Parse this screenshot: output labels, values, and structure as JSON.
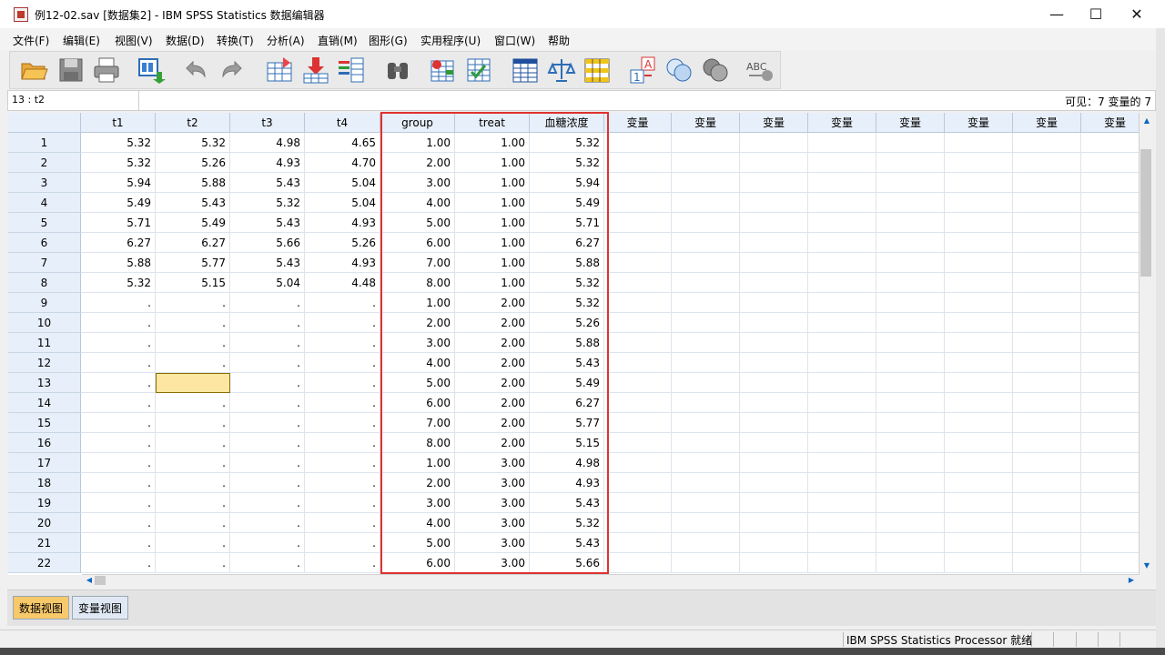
{
  "window": {
    "title": "例12-02.sav [数据集2] - IBM SPSS Statistics 数据编辑器",
    "minimize": "—",
    "maximize": "☐",
    "close": "✕"
  },
  "menu": [
    "文件(F)",
    "编辑(E)",
    "视图(V)",
    "数据(D)",
    "转换(T)",
    "分析(A)",
    "直销(M)",
    "图形(G)",
    "实用程序(U)",
    "窗口(W)",
    "帮助"
  ],
  "toolbar_icons": [
    "open-file-icon",
    "save-icon",
    "print-icon",
    "recall-dialog-icon",
    "undo-icon",
    "redo-icon",
    "goto-case-icon",
    "goto-variable-icon",
    "variables-icon",
    "find-icon",
    "insert-cases-icon",
    "insert-variable-icon",
    "split-file-icon",
    "weight-cases-icon",
    "select-cases-icon",
    "value-labels-icon",
    "use-sets-icon",
    "show-all-variables-icon",
    "spell-check-icon"
  ],
  "cell_reference": "13 : t2",
  "visible_info": "可见：7 变量的 7",
  "columns": [
    "t1",
    "t2",
    "t3",
    "t4",
    "group",
    "treat",
    "血糖浓度",
    "变量",
    "变量",
    "变量",
    "变量",
    "变量",
    "变量",
    "变量",
    "变量"
  ],
  "rows": [
    {
      "n": "1",
      "t1": "5.32",
      "t2": "5.32",
      "t3": "4.98",
      "t4": "4.65",
      "group": "1.00",
      "treat": "1.00",
      "xt": "5.32"
    },
    {
      "n": "2",
      "t1": "5.32",
      "t2": "5.26",
      "t3": "4.93",
      "t4": "4.70",
      "group": "2.00",
      "treat": "1.00",
      "xt": "5.32"
    },
    {
      "n": "3",
      "t1": "5.94",
      "t2": "5.88",
      "t3": "5.43",
      "t4": "5.04",
      "group": "3.00",
      "treat": "1.00",
      "xt": "5.94"
    },
    {
      "n": "4",
      "t1": "5.49",
      "t2": "5.43",
      "t3": "5.32",
      "t4": "5.04",
      "group": "4.00",
      "treat": "1.00",
      "xt": "5.49"
    },
    {
      "n": "5",
      "t1": "5.71",
      "t2": "5.49",
      "t3": "5.43",
      "t4": "4.93",
      "group": "5.00",
      "treat": "1.00",
      "xt": "5.71"
    },
    {
      "n": "6",
      "t1": "6.27",
      "t2": "6.27",
      "t3": "5.66",
      "t4": "5.26",
      "group": "6.00",
      "treat": "1.00",
      "xt": "6.27"
    },
    {
      "n": "7",
      "t1": "5.88",
      "t2": "5.77",
      "t3": "5.43",
      "t4": "4.93",
      "group": "7.00",
      "treat": "1.00",
      "xt": "5.88"
    },
    {
      "n": "8",
      "t1": "5.32",
      "t2": "5.15",
      "t3": "5.04",
      "t4": "4.48",
      "group": "8.00",
      "treat": "1.00",
      "xt": "5.32"
    },
    {
      "n": "9",
      "t1": ".",
      "t2": ".",
      "t3": ".",
      "t4": ".",
      "group": "1.00",
      "treat": "2.00",
      "xt": "5.32"
    },
    {
      "n": "10",
      "t1": ".",
      "t2": ".",
      "t3": ".",
      "t4": ".",
      "group": "2.00",
      "treat": "2.00",
      "xt": "5.26"
    },
    {
      "n": "11",
      "t1": ".",
      "t2": ".",
      "t3": ".",
      "t4": ".",
      "group": "3.00",
      "treat": "2.00",
      "xt": "5.88"
    },
    {
      "n": "12",
      "t1": ".",
      "t2": ".",
      "t3": ".",
      "t4": ".",
      "group": "4.00",
      "treat": "2.00",
      "xt": "5.43"
    },
    {
      "n": "13",
      "t1": ".",
      "t2": "",
      "t3": ".",
      "t4": ".",
      "group": "5.00",
      "treat": "2.00",
      "xt": "5.49"
    },
    {
      "n": "14",
      "t1": ".",
      "t2": ".",
      "t3": ".",
      "t4": ".",
      "group": "6.00",
      "treat": "2.00",
      "xt": "6.27"
    },
    {
      "n": "15",
      "t1": ".",
      "t2": ".",
      "t3": ".",
      "t4": ".",
      "group": "7.00",
      "treat": "2.00",
      "xt": "5.77"
    },
    {
      "n": "16",
      "t1": ".",
      "t2": ".",
      "t3": ".",
      "t4": ".",
      "group": "8.00",
      "treat": "2.00",
      "xt": "5.15"
    },
    {
      "n": "17",
      "t1": ".",
      "t2": ".",
      "t3": ".",
      "t4": ".",
      "group": "1.00",
      "treat": "3.00",
      "xt": "4.98"
    },
    {
      "n": "18",
      "t1": ".",
      "t2": ".",
      "t3": ".",
      "t4": ".",
      "group": "2.00",
      "treat": "3.00",
      "xt": "4.93"
    },
    {
      "n": "19",
      "t1": ".",
      "t2": ".",
      "t3": ".",
      "t4": ".",
      "group": "3.00",
      "treat": "3.00",
      "xt": "5.43"
    },
    {
      "n": "20",
      "t1": ".",
      "t2": ".",
      "t3": ".",
      "t4": ".",
      "group": "4.00",
      "treat": "3.00",
      "xt": "5.32"
    },
    {
      "n": "21",
      "t1": ".",
      "t2": ".",
      "t3": ".",
      "t4": ".",
      "group": "5.00",
      "treat": "3.00",
      "xt": "5.43"
    },
    {
      "n": "22",
      "t1": ".",
      "t2": ".",
      "t3": ".",
      "t4": ".",
      "group": "6.00",
      "treat": "3.00",
      "xt": "5.66"
    }
  ],
  "selected_cell": {
    "row": "13",
    "column": "t2"
  },
  "tabs": {
    "data_view": "数据视图",
    "variable_view": "变量视图"
  },
  "status": "IBM SPSS Statistics Processor 就绪",
  "colors": {
    "highlight_box": "#e0322f",
    "selected_cell": "#fde6a1",
    "header_bg": "#e7effa",
    "active_tab": "#f7c96a"
  }
}
